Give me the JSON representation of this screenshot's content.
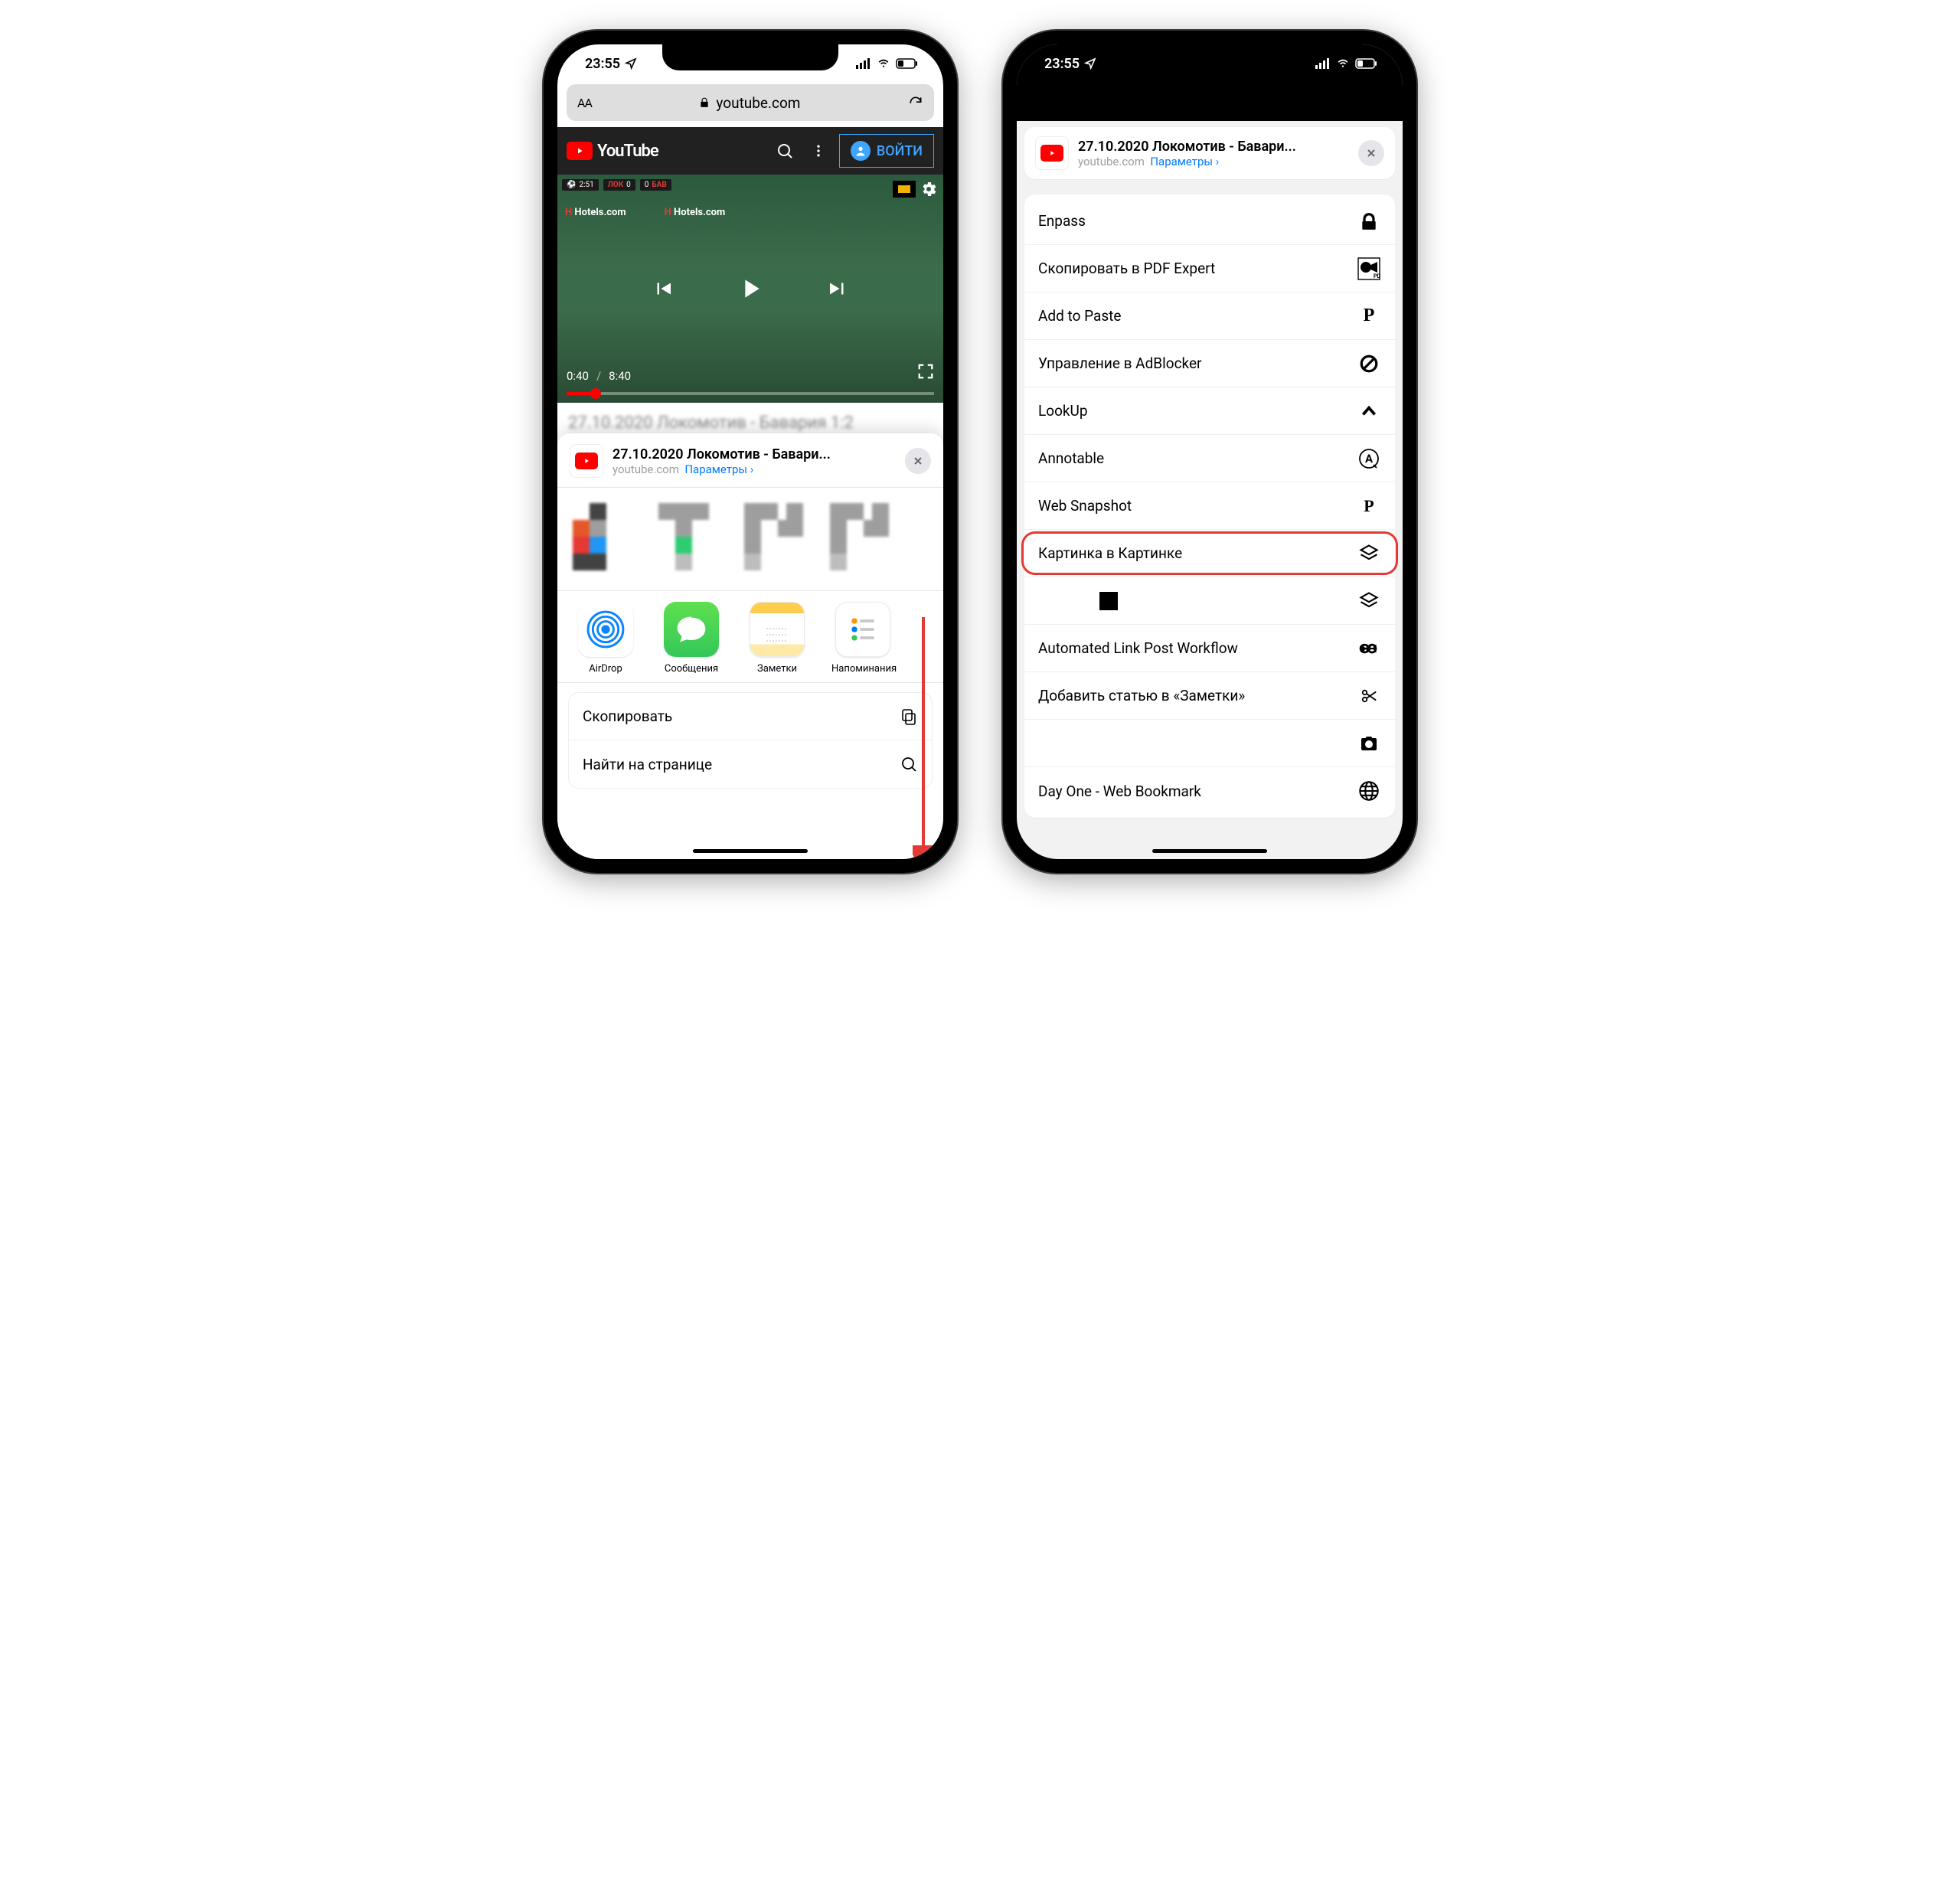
{
  "status": {
    "time": "23:55"
  },
  "browser": {
    "domain": "youtube.com"
  },
  "youtube": {
    "brand": "YouTube",
    "signin": "ВОЙТИ",
    "scoreboard": {
      "match_time": "2:51",
      "home_abbr": "ЛОК",
      "home_score": "0",
      "away_score": "0",
      "away_abbr": "БАВ"
    },
    "ad_banner": "Hotels.com",
    "time_current": "0:40",
    "time_total": "8:40",
    "title_cut": "27.10.2020 Локомотив - Бавария 1:2"
  },
  "share": {
    "title": "27.10.2020 Локомотив - Бавари...",
    "domain": "youtube.com",
    "params": "Параметры",
    "apps": [
      {
        "name": "AirDrop"
      },
      {
        "name": "Сообщения"
      },
      {
        "name": "Заметки"
      },
      {
        "name": "Напоминания"
      }
    ],
    "actions": [
      {
        "label": "Скопировать"
      },
      {
        "label": "Найти на странице"
      }
    ]
  },
  "sheet2": {
    "header": {
      "title": "27.10.2020 Локомотив - Бавари...",
      "domain": "youtube.com",
      "params": "Параметры"
    },
    "rows": [
      {
        "label": "Enpass",
        "icon": "enpass"
      },
      {
        "label": "Скопировать в PDF Expert",
        "icon": "pdf"
      },
      {
        "label": "Add to Paste",
        "icon": "paste"
      },
      {
        "label": "Управление в AdBlocker",
        "icon": "block"
      },
      {
        "label": "LookUp",
        "icon": "chevup"
      },
      {
        "label": "Annotable",
        "icon": "annot"
      },
      {
        "label": "Web Snapshot",
        "icon": "psnap"
      },
      {
        "label": "Картинка в Картинке",
        "icon": "layers",
        "highlight": true
      },
      {
        "label": "",
        "icon": "layers",
        "black_square": true
      },
      {
        "label": "Automated Link Post Workflow",
        "icon": "infinity"
      },
      {
        "label": "Добавить статью в «Заметки»",
        "icon": "scissors"
      },
      {
        "label": "",
        "icon": "camera"
      },
      {
        "label": "Day One - Web Bookmark",
        "icon": "globe"
      }
    ]
  }
}
